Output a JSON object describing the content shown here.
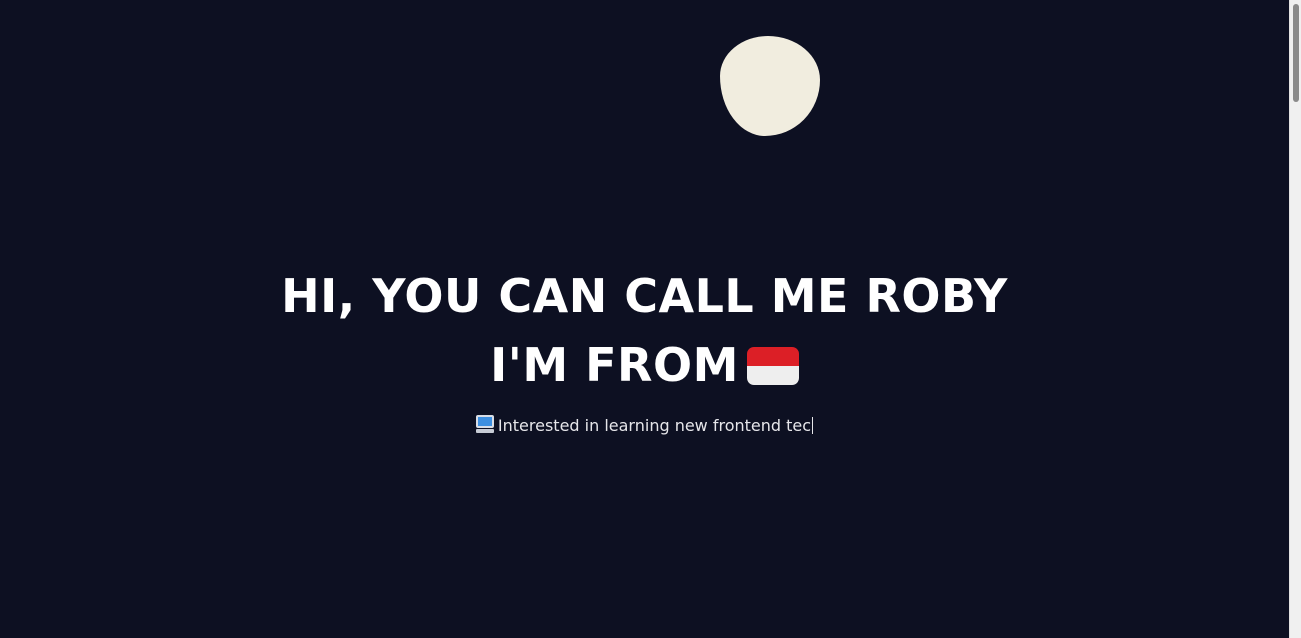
{
  "hero": {
    "line1": "HI, YOU CAN CALL ME ROBY",
    "line2": "I'M FROM",
    "flag_icon": "indonesia-flag-icon",
    "flag_colors": [
      "#dc1f26",
      "#eeeeee"
    ]
  },
  "subtitle": {
    "icon": "computer-icon",
    "text": "Interested in learning new frontend tec"
  },
  "colors": {
    "background": "#0d1022",
    "blob": "#f1eddf",
    "text": "#ffffff"
  }
}
